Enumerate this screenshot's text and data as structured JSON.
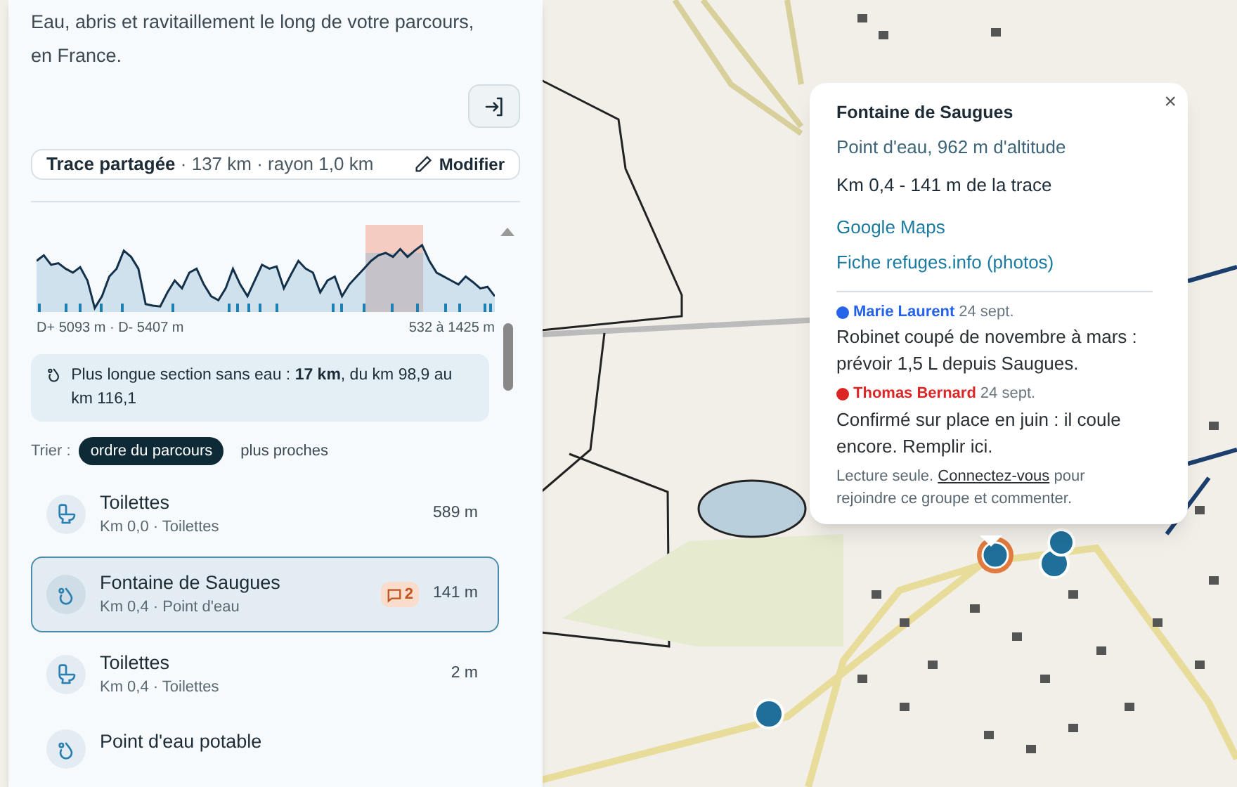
{
  "sidebar": {
    "intro": "Eau, abris et ravitaillement le long de votre parcours, en France.",
    "trace": {
      "label": "Trace partagée",
      "details": " · 137 km · rayon 1,0 km",
      "edit": "Modifier"
    },
    "profile": {
      "gain": "D+ 5093 m · D- 5407 m",
      "range": "532 à 1425 m"
    },
    "dry_section": "Plus longue section sans eau : **17 km**, du km 98,9 au km 116,1",
    "sort": {
      "label": "Trier :",
      "options": [
        {
          "label": "ordre du parcours",
          "selected": true
        },
        {
          "label": "plus proches",
          "selected": false
        }
      ]
    },
    "items": [
      {
        "kind": "toilet",
        "title": "Toilettes",
        "subtitle": "Km 0,0 · Toilettes",
        "distance": "589 m",
        "selected": false
      },
      {
        "kind": "water",
        "title": "Fontaine de Saugues",
        "subtitle": "Km 0,4 · Point d'eau",
        "comments": "2",
        "distance": "141 m",
        "selected": true
      },
      {
        "kind": "toilet",
        "title": "Toilettes",
        "subtitle": "Km 0,4 · Toilettes",
        "distance": "2 m",
        "selected": false
      },
      {
        "kind": "water",
        "title": "Point d'eau potable",
        "selected": false
      }
    ]
  },
  "popup": {
    "close": "×",
    "title": "Fontaine de Saugues",
    "type": "Point d'eau, 962 m d'altitude",
    "position": "Km 0,4 - 141 m de la trace",
    "links": [
      "Google Maps",
      "Fiche refuges.info (photos)"
    ],
    "comments": [
      {
        "author": "Marie Laurent",
        "color": "#2563eb",
        "date": "24 sept.",
        "text": "Robinet coupé de novembre à mars : prévoir 1,5 L depuis Saugues."
      },
      {
        "author": "Thomas Bernard",
        "color": "#dc2626",
        "date": "24 sept.",
        "text": "Confirmé sur place en juin : il coule encore. Remplir ici."
      }
    ],
    "footer": {
      "before": "Lecture seule. ",
      "link": "Connectez-vous",
      "after": " pour rejoindre ce groupe et commenter."
    }
  }
}
